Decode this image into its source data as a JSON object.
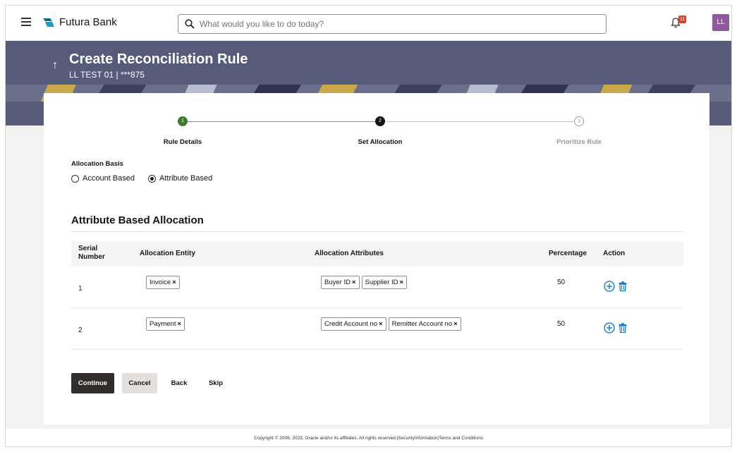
{
  "header": {
    "brand": "Futura Bank",
    "search_placeholder": "What would you like to do today?",
    "notification_count": "11",
    "avatar_initials": "LL"
  },
  "banner": {
    "title": "Create Reconciliation Rule",
    "subtitle": "LL TEST 01 | ***875"
  },
  "stepper": {
    "steps": [
      {
        "number": "1",
        "label": "Rule Details",
        "state": "completed"
      },
      {
        "number": "2",
        "label": "Set Allocation",
        "state": "active"
      },
      {
        "number": "3",
        "label": "Prioritize Rule",
        "state": "pending"
      }
    ]
  },
  "allocation_basis": {
    "label": "Allocation Basis",
    "options": [
      "Account Based",
      "Attribute Based"
    ],
    "selected": "Attribute Based"
  },
  "section": {
    "title": "Attribute Based Allocation"
  },
  "table": {
    "headers": {
      "serial_line1": "Serial",
      "serial_line2": "Number",
      "entity": "Allocation Entity",
      "attributes": "Allocation Attributes",
      "percentage": "Percentage",
      "action": "Action"
    },
    "rows": [
      {
        "serial": "1",
        "entity": "Invoice",
        "attributes": [
          "Buyer ID",
          "Supplier ID"
        ],
        "percentage": "50"
      },
      {
        "serial": "2",
        "entity": "Payment",
        "attributes": [
          "Credit Account no",
          "Remitter Account no"
        ],
        "percentage": "50"
      }
    ],
    "chip_close": "×"
  },
  "buttons": {
    "continue": "Continue",
    "cancel": "Cancel",
    "back": "Back",
    "skip": "Skip"
  },
  "footer": {
    "text": "Copyright © 2006, 2023, Oracle and/or its affiliates. All rights reserved.|SecurityInformation|Terms and Conditions"
  },
  "colors": {
    "banner": "#575b7a",
    "step_completed": "#3d7a2b",
    "primary_button": "#312d2a",
    "badge": "#c74634",
    "action_icon": "#0572ce"
  }
}
